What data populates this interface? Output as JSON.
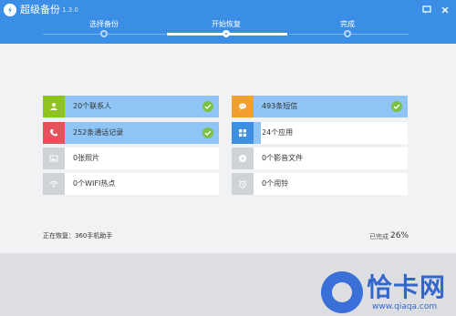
{
  "app": {
    "title": "超级备份",
    "version": "1.3.0"
  },
  "steps": [
    {
      "label": "选择备份"
    },
    {
      "label": "开始恢复"
    },
    {
      "label": "完成"
    }
  ],
  "items": [
    {
      "label": "20个联系人",
      "icon": "contact-icon",
      "icon_color": "#8fc31f",
      "progress": 1.0,
      "done": true
    },
    {
      "label": "493条短信",
      "icon": "sms-icon",
      "icon_color": "#f0a030",
      "progress": 1.0,
      "done": true
    },
    {
      "label": "252条通话记录",
      "icon": "phone-icon",
      "icon_color": "#e8505b",
      "progress": 1.0,
      "done": true
    },
    {
      "label": "24个应用",
      "icon": "apps-icon",
      "icon_color": "#3d8fe0",
      "progress": 0.05,
      "done": false
    },
    {
      "label": "0张照片",
      "icon": "photo-icon",
      "icon_color": "#cfd2d6",
      "progress": 0,
      "done": false
    },
    {
      "label": "0个影音文件",
      "icon": "media-icon",
      "icon_color": "#cfd2d6",
      "progress": 0,
      "done": false
    },
    {
      "label": "0个WIFI热点",
      "icon": "wifi-icon",
      "icon_color": "#cfd2d6",
      "progress": 0,
      "done": false
    },
    {
      "label": "0个闹铃",
      "icon": "alarm-icon",
      "icon_color": "#cfd2d6",
      "progress": 0,
      "done": false
    }
  ],
  "status": {
    "restoring": "正在恢复：360手机助手",
    "complete_label": "已完成",
    "complete_pct": "26%"
  },
  "watermark": {
    "cn": "恰卡网",
    "url": "www.qiaqa.com"
  },
  "colors": {
    "header": "#3a8ee6",
    "progress_fill": "#8ec5f6",
    "check": "#7cc242"
  }
}
